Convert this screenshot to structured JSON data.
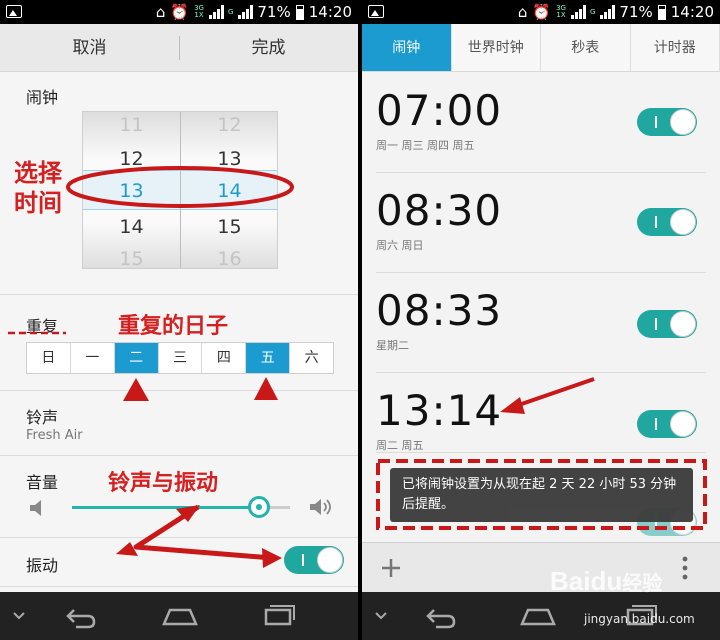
{
  "status": {
    "battery_pct": "71%",
    "time": "14:20",
    "net1": "3G",
    "net2": "1X",
    "net3": "G"
  },
  "left": {
    "cancel": "取消",
    "done": "完成",
    "alarm_label": "闹钟",
    "picker": {
      "hours": [
        "11",
        "12",
        "13",
        "14",
        "15"
      ],
      "minutes": [
        "12",
        "13",
        "14",
        "15",
        "16"
      ]
    },
    "repeat_label": "重复",
    "weekdays": [
      {
        "label": "日",
        "selected": false
      },
      {
        "label": "一",
        "selected": false
      },
      {
        "label": "二",
        "selected": true
      },
      {
        "label": "三",
        "selected": false
      },
      {
        "label": "四",
        "selected": false
      },
      {
        "label": "五",
        "selected": true
      },
      {
        "label": "六",
        "selected": false
      }
    ],
    "ringtone_label": "铃声",
    "ringtone_value": "Fresh Air",
    "volume_label": "音量",
    "volume_level": 0.86,
    "vibrate_label": "振动",
    "vibrate_on": true
  },
  "annotations": {
    "select_time_1": "选择",
    "select_time_2": "时间",
    "repeat_days": "重复的日子",
    "ring_vibrate": "铃声与振动"
  },
  "right": {
    "tabs": [
      "闹钟",
      "世界时钟",
      "秒表",
      "计时器"
    ],
    "active_tab": 0,
    "alarms": [
      {
        "time": "07:00",
        "days": "周一 周三 周四 周五",
        "on": true
      },
      {
        "time": "08:30",
        "days": "周六 周日",
        "on": true
      },
      {
        "time": "08:33",
        "days": "星期二",
        "on": true
      },
      {
        "time": "13:14",
        "days": "周二 周五",
        "on": true
      }
    ],
    "toast": "已将闹钟设置为从现在起 2 天 22 小时 53 分钟后提醒。",
    "add_icon": "plus-icon",
    "menu_icon": "overflow-menu-icon"
  },
  "watermark": {
    "brand": "Baidu",
    "brand_cn": "经验",
    "url": "jingyan.baidu.com"
  },
  "colors": {
    "accent": "#1c9bd0",
    "toggle": "#20a8a0",
    "annotation": "#d42020"
  }
}
